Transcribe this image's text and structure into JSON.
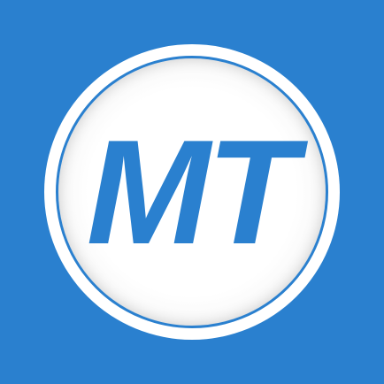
{
  "app_icon": {
    "monogram": "MT",
    "colors": {
      "background": "#2a80cf",
      "badge": "#ffffff",
      "monogram": "#2a80cf"
    }
  }
}
